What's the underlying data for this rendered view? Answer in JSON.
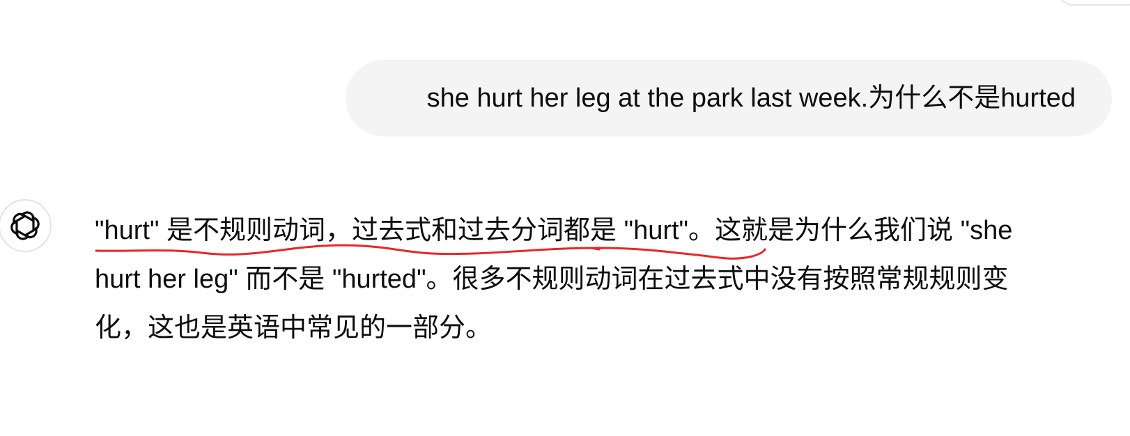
{
  "conversation": {
    "user_message": "she hurt her leg at the park last week.为什么不是hurted",
    "assistant_message": {
      "lines": [
        "\"hurt\" 是不规则动词，过去式和过去分词都是 \"hurt\"。这就是为什么我们说 \"she",
        "hurt her leg\" 而不是 \"hurted\"。很多不规则动词在过去式中没有按照常规规则变",
        "化，这也是英语中常见的一部分。"
      ]
    },
    "assistant_avatar_icon": "openai-logo-icon"
  },
  "annotation": {
    "color": "#e8262b",
    "type": "hand-drawn-underline"
  }
}
